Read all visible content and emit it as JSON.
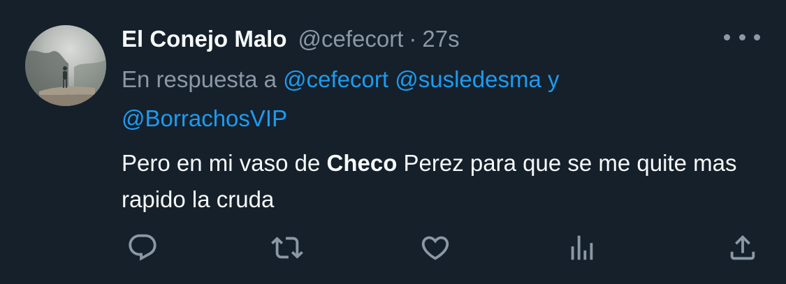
{
  "tweet": {
    "display_name": "El Conejo Malo",
    "handle": "@cefecort",
    "separator": "·",
    "time": "27s",
    "reply_prefix": "En respuesta a",
    "reply_mentions": [
      "@cefecort",
      "@susledesma"
    ],
    "reply_conjunction": "y",
    "reply_mention_last": "@BorrachosVIP",
    "text_before": "Pero en mi vaso de",
    "text_bold": "Checo",
    "text_after": "Perez para que se me quite mas rapido la cruda"
  },
  "icons": {
    "more": "more-horizontal-icon",
    "reply": "reply-icon",
    "retweet": "retweet-icon",
    "like": "like-icon",
    "views": "views-icon",
    "share": "share-icon"
  },
  "colors": {
    "background": "#15202b",
    "text_primary": "#f7f9f9",
    "text_secondary": "#8b98a5",
    "accent": "#1d9bf0"
  }
}
